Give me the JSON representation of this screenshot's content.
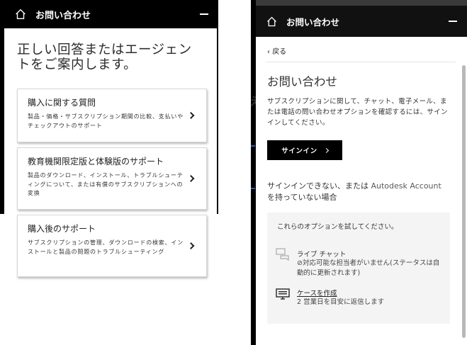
{
  "left_panel": {
    "header_title": "お問い合わせ",
    "heading": "正しい回答またはエージェントをご案内します。",
    "cards": [
      {
        "title": "購入に関する質問",
        "desc": "製品・価格・サブスクリプション期間の比較、支払いやチェックアウトのサポート"
      },
      {
        "title": "教育機関限定版と体験版のサポート",
        "desc": "製品のダウンロード、インストール、トラブルシューティングについて、または有償のサブスクリプションへの変換"
      },
      {
        "title": "購入後のサポート",
        "desc": "サブスクリプションの管理、ダウンロードの検索、インストールと製品の問題のトラブルシューティング"
      }
    ]
  },
  "right_panel": {
    "header_title": "お問い合わせ",
    "back_label": "戻る",
    "title": "お問い合わせ",
    "description": "サブスクリプションに関して、チャット、電子メール、または電話の問い合わせオプションを確認するには、サインインしてください。",
    "signin_label": "サインイン",
    "no_signin_prefix": "サインインできない、または ",
    "no_signin_link": "Autodesk Account",
    "no_signin_suffix": " を持っていない場合",
    "options_intro": "これらのオプションを試してください。",
    "options": [
      {
        "icon": "chat-bubbles-icon",
        "title": "ライブ チャット",
        "subtitle": "対応可能な担当者がいません(ステータスは自動的に更新されます)"
      },
      {
        "icon": "monitor-icon",
        "title": "ケースを作成",
        "subtitle": "2 営業日を目安に返信します"
      }
    ]
  },
  "background": {
    "stray_char": "え"
  },
  "colors": {
    "header_bg": "#000000",
    "link_color": "#5a5a5a",
    "options_bg": "#f4f4f4"
  }
}
